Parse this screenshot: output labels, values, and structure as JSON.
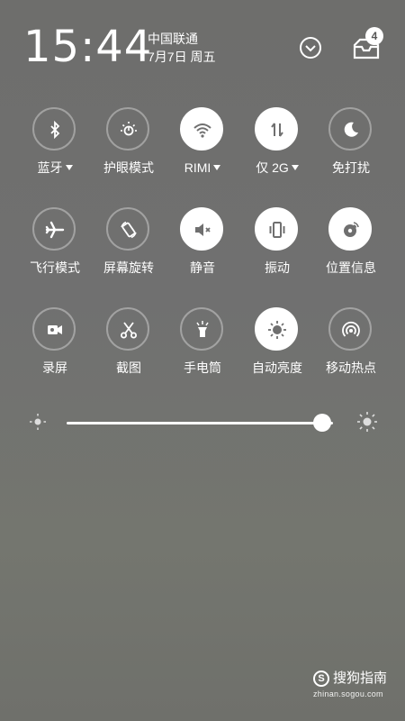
{
  "status": {
    "time": "15:44",
    "carrier": "中国联通",
    "date": "7月7日 周五",
    "notification_count": "4"
  },
  "tiles": {
    "bluetooth": "蓝牙",
    "eye_care": "护眼模式",
    "wifi": "RIMI",
    "data": "仅 2G",
    "dnd": "免打扰",
    "airplane": "飞行模式",
    "rotation": "屏幕旋转",
    "mute": "静音",
    "vibrate": "振动",
    "location": "位置信息",
    "record": "录屏",
    "screenshot": "截图",
    "flashlight": "手电筒",
    "auto_brightness": "自动亮度",
    "hotspot": "移动热点"
  },
  "brightness": {
    "level": 0.96
  },
  "watermark": {
    "title": "搜狗指南",
    "url": "zhinan.sogou.com",
    "logo": "S"
  }
}
